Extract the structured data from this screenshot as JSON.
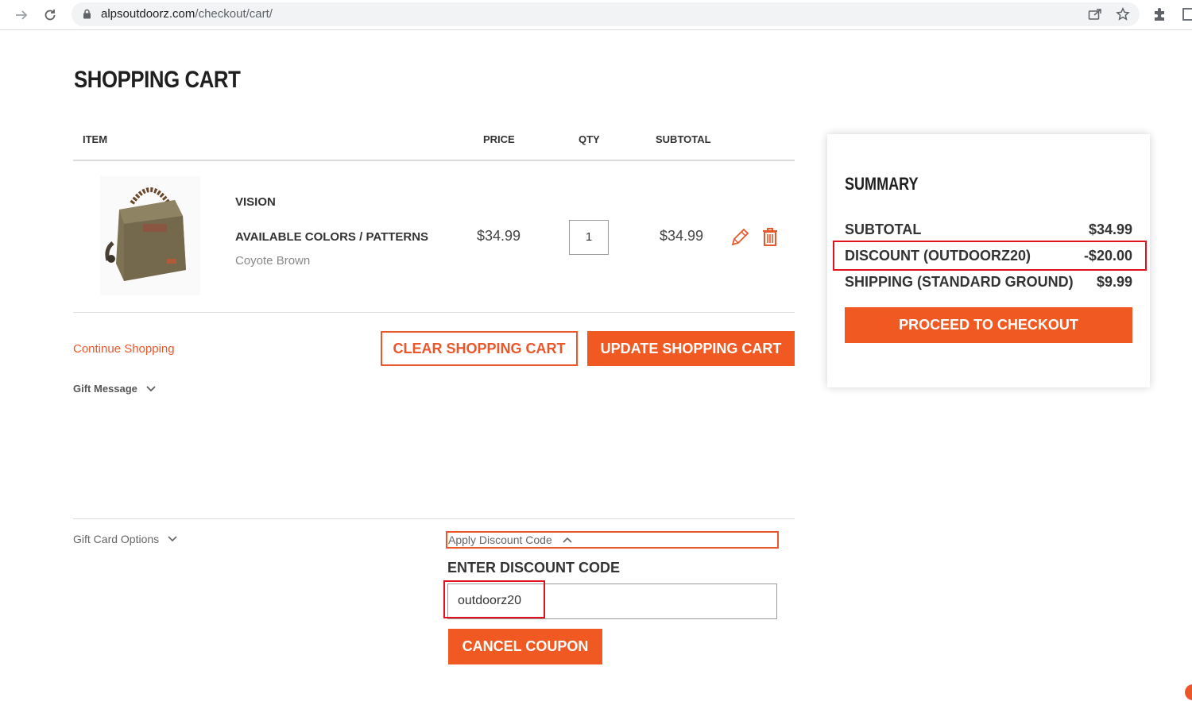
{
  "browser": {
    "url_domain": "alpsoutdoorz.com",
    "url_path": "/checkout/cart/"
  },
  "page": {
    "title": "SHOPPING CART"
  },
  "table": {
    "headers": {
      "item": "ITEM",
      "price": "PRICE",
      "qty": "QTY",
      "subtotal": "SUBTOTAL"
    }
  },
  "item": {
    "name": "VISION",
    "option_label": "AVAILABLE COLORS / PATTERNS",
    "option_value": "Coyote Brown",
    "price": "$34.99",
    "qty": "1",
    "subtotal": "$34.99"
  },
  "actions": {
    "continue": "Continue Shopping",
    "clear": "CLEAR SHOPPING CART",
    "update": "UPDATE SHOPPING CART"
  },
  "gift_message": "Gift Message",
  "gift_card": "Gift Card Options",
  "discount": {
    "toggle": "Apply Discount Code",
    "label": "ENTER DISCOUNT CODE",
    "value": "outdoorz20",
    "cancel": "CANCEL COUPON"
  },
  "summary": {
    "title": "SUMMARY",
    "subtotal_label": "SUBTOTAL",
    "subtotal_value": "$34.99",
    "discount_label": "DISCOUNT (OUTDOORZ20)",
    "discount_value": "-$20.00",
    "shipping_label": "SHIPPING (STANDARD GROUND)",
    "shipping_value": "$9.99",
    "checkout": "PROCEED TO CHECKOUT"
  },
  "colors": {
    "accent": "#f05a22",
    "link": "#e9572b",
    "highlight": "#e0121f"
  },
  "icons": [
    "back-icon",
    "reload-icon",
    "lock-icon",
    "share-icon",
    "star-icon",
    "extensions-icon",
    "window-icon",
    "edit-icon",
    "trash-icon",
    "chevron-down-icon",
    "chevron-up-icon"
  ]
}
